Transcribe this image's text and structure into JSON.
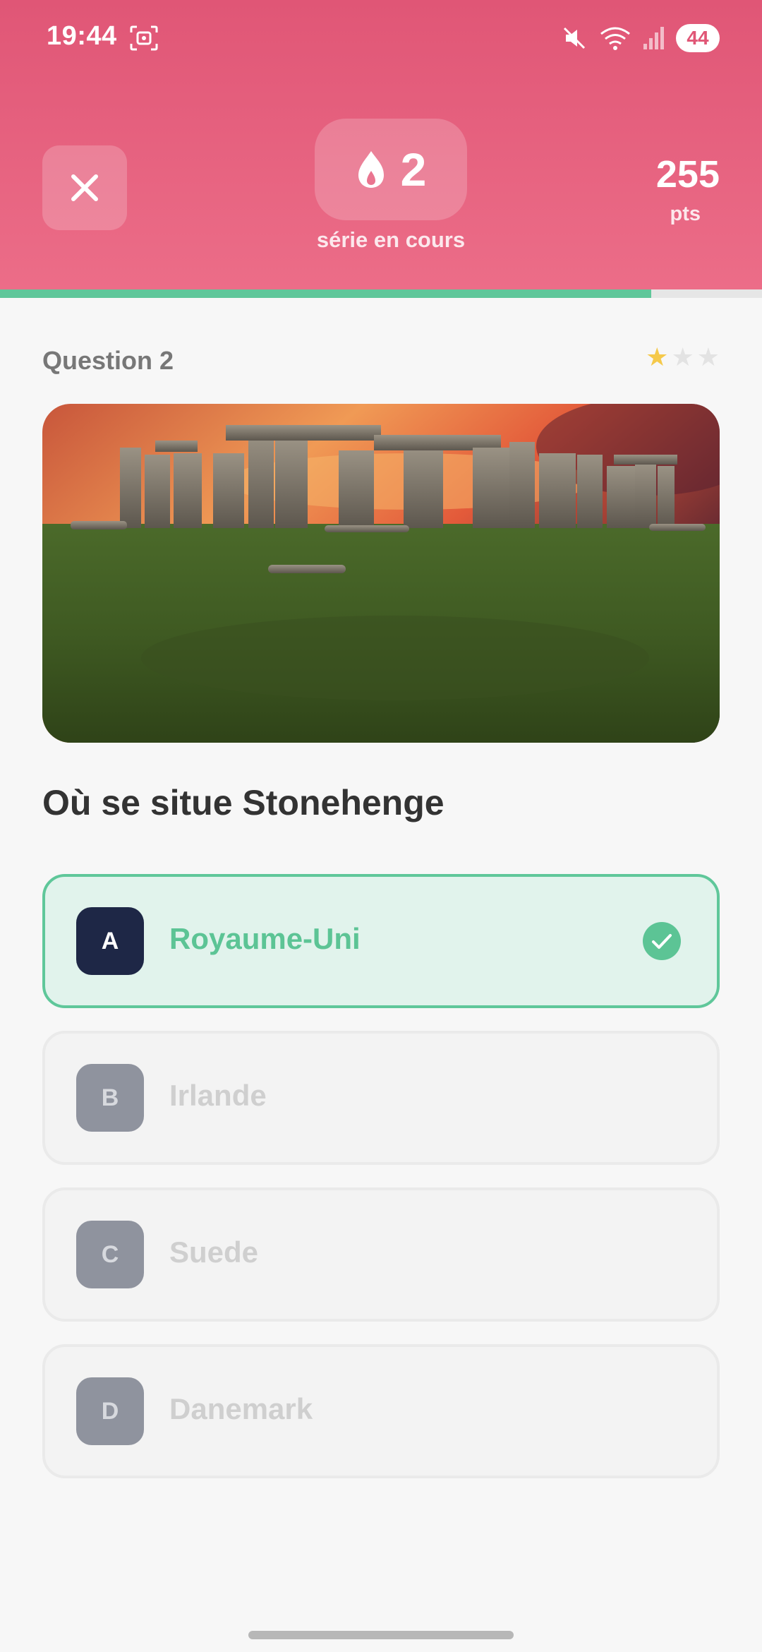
{
  "status_bar": {
    "time": "19:44",
    "battery": "44",
    "icons": [
      "screenshot-icon",
      "mute-icon",
      "wifi-icon",
      "signal-icon",
      "battery-icon"
    ]
  },
  "header": {
    "close_icon": "close-icon",
    "streak": {
      "icon": "flame-icon",
      "count": "2",
      "label": "série en cours"
    },
    "points": {
      "value": "255",
      "unit": "pts"
    }
  },
  "progress": {
    "fraction": 0.855,
    "color": "#5fc79a"
  },
  "question": {
    "number_label": "Question 2",
    "difficulty": {
      "filled": 1,
      "total": 3
    },
    "image": "stonehenge-photo",
    "text": "Où se situe Stonehenge"
  },
  "answers": [
    {
      "letter": "A",
      "label": "Royaume-Uni",
      "state": "correct"
    },
    {
      "letter": "B",
      "label": "Irlande",
      "state": "disabled"
    },
    {
      "letter": "C",
      "label": "Suede",
      "state": "disabled"
    },
    {
      "letter": "D",
      "label": "Danemark",
      "state": "disabled"
    }
  ],
  "colors": {
    "header_top": "#e05676",
    "header_bottom": "#ec6d88",
    "correct_green": "#5cc495",
    "badge_navy": "#1e2746"
  }
}
